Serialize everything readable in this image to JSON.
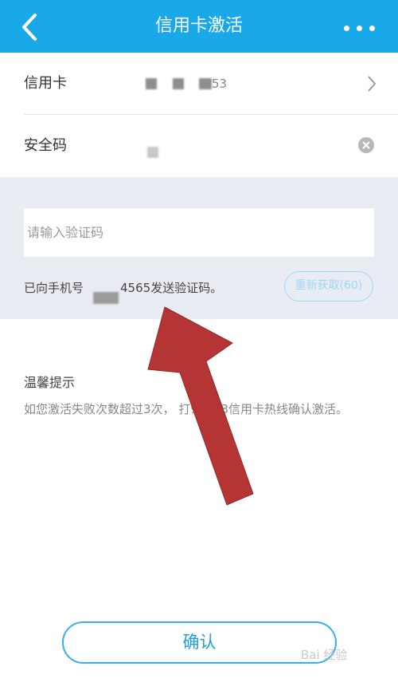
{
  "header": {
    "title": "信用卡激活"
  },
  "form": {
    "card_label": "信用卡",
    "card_number_tail": "53",
    "security_label": "安全码",
    "code_placeholder": "请输入验证码",
    "sent_prefix": "已向手机号",
    "sent_suffix": "4565发送验证码。",
    "resend_label": "重新获取(60)"
  },
  "tips": {
    "title": "温馨提示",
    "text": "如您激活失败次数超过3次，    打95533信用卡热线确认激活。"
  },
  "footer": {
    "confirm_label": "确认",
    "watermark": "Bai 经验"
  },
  "colors": {
    "header": "#1aa9e8",
    "accent": "#1f9fe0",
    "arrow": "#b53535"
  }
}
